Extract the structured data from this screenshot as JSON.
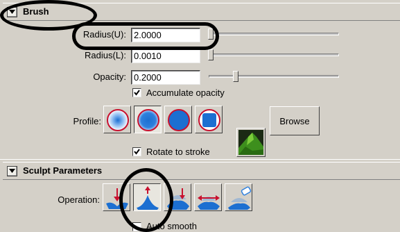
{
  "brush_section": {
    "title": "Brush",
    "radius_u": {
      "label": "Radius(U):",
      "value": "2.0000"
    },
    "radius_l": {
      "label": "Radius(L):",
      "value": "0.0010"
    },
    "opacity": {
      "label": "Opacity:",
      "value": "0.2000"
    },
    "accumulate_opacity": {
      "label": "Accumulate opacity",
      "checked": true
    },
    "profile": {
      "label": "Profile:",
      "options": [
        "gaussian-brush-icon",
        "soft-brush-icon",
        "solid-brush-icon",
        "square-brush-icon",
        "custom-brush-image-icon"
      ],
      "selected_index": 1
    },
    "browse_label": "Browse",
    "rotate_to_stroke": {
      "label": "Rotate to stroke",
      "checked": true
    }
  },
  "sculpt_section": {
    "title": "Sculpt Parameters",
    "operation": {
      "label": "Operation:",
      "options": [
        "push-icon",
        "pull-icon",
        "smooth-icon",
        "relax-icon",
        "erase-icon"
      ],
      "selected_index": 1
    },
    "auto_smooth": {
      "label": "Auto smooth"
    }
  },
  "colors": {
    "panel": "#d4d0c8",
    "brush_red": "#c8102e",
    "brush_blue": "#1c6fd1",
    "annotation": "#000000"
  }
}
